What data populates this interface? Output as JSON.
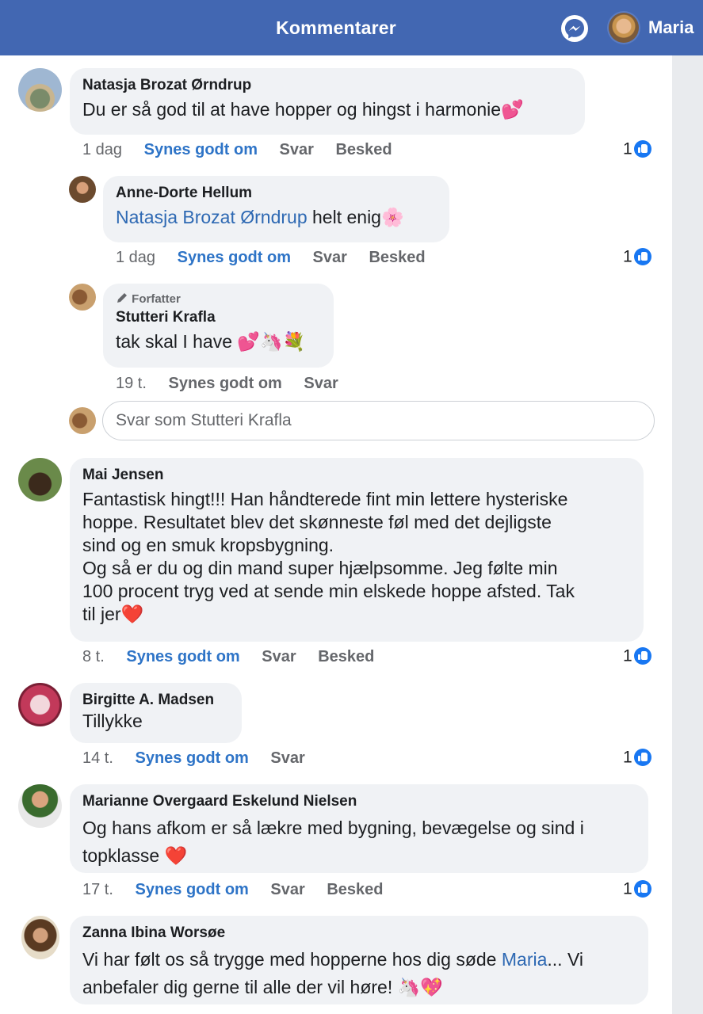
{
  "header": {
    "title": "Kommentarer",
    "user_name": "Maria"
  },
  "comments": [
    {
      "author": "Natasja Brozat Ørndrup",
      "text": "Du er så god til at have hopper og hingst i harmonie💕",
      "time": "1 dag",
      "like_label": "Synes godt om",
      "reply_label": "Svar",
      "message_label": "Besked",
      "likes": "1"
    },
    {
      "author": "Anne-Dorte Hellum",
      "mention": "Natasja Brozat Ørndrup",
      "text": " helt enig🌸",
      "time": "1 dag",
      "like_label": "Synes godt om",
      "reply_label": "Svar",
      "message_label": "Besked",
      "likes": "1"
    },
    {
      "badge": "Forfatter",
      "author": "Stutteri Krafla",
      "text": "tak skal I have 💕🦄💐",
      "time": "19 t.",
      "like_label": "Synes godt om",
      "reply_label": "Svar"
    },
    {
      "author": "Mai Jensen",
      "text_lines": [
        "Fantastisk hingt!!! Han håndterede fint min lettere  hysteriske",
        "hoppe.  Resultatet blev det skønneste føl med det dejligste",
        "sind og en smuk kropsbygning.",
        "Og så er du og din mand super hjælpsomme. Jeg følte min",
        "100 procent tryg ved at sende min elskede hoppe afsted. Tak",
        "til jer❤️"
      ],
      "time": "8 t.",
      "like_label": "Synes godt om",
      "reply_label": "Svar",
      "message_label": "Besked",
      "likes": "1"
    },
    {
      "author": "Birgitte A. Madsen",
      "text": "Tillykke",
      "time": "14 t.",
      "like_label": "Synes godt om",
      "reply_label": "Svar",
      "likes": "1"
    },
    {
      "author": "Marianne Overgaard Eskelund Nielsen",
      "text_lines": [
        "Og hans afkom er så lækre med bygning, bevægelse og sind i",
        "topklasse ❤️"
      ],
      "time": "17 t.",
      "like_label": "Synes godt om",
      "reply_label": "Svar",
      "message_label": "Besked",
      "likes": "1"
    },
    {
      "author": "Zanna Ibina Worsøe",
      "line1_pre": "Vi har følt os så trygge med hopperne hos dig søde ",
      "mention": "Maria",
      "line1_post": "... Vi",
      "line2": "anbefaler dig gerne til alle der vil høre! 🦄💖"
    }
  ],
  "reply_input": {
    "placeholder": "Svar som Stutteri Krafla"
  },
  "colors": {
    "header_bg": "#4267b2",
    "bubble_bg": "#f0f2f5",
    "link_blue": "#2e69b3",
    "like_icon": "#1877f2"
  },
  "icons": [
    "messenger-icon",
    "pencil-icon",
    "like-thumb-icon"
  ]
}
